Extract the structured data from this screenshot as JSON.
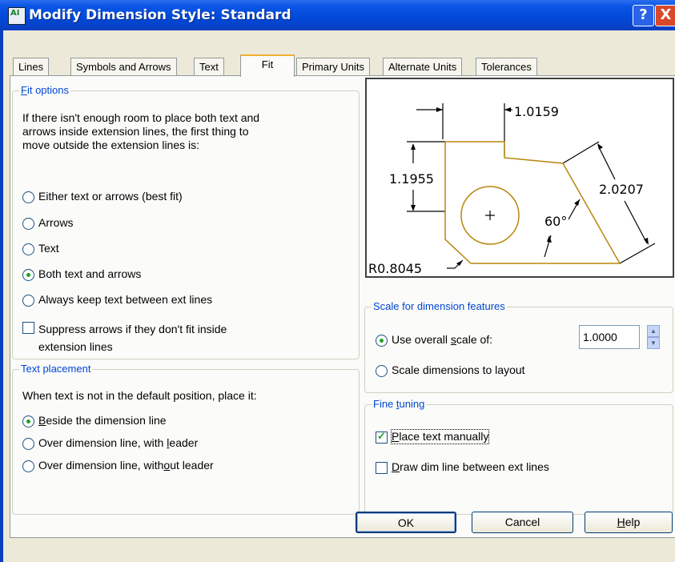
{
  "window": {
    "title": "Modify Dimension Style: Standard",
    "icon_label": "AI",
    "help_label": "?",
    "close_label": "X"
  },
  "tabs": [
    "Lines",
    "Symbols and Arrows",
    "Text",
    "Fit",
    "Primary Units",
    "Alternate Units",
    "Tolerances"
  ],
  "active_tab": "Fit",
  "fit_options": {
    "title_pre": "",
    "title_u": "F",
    "title_post": "it options",
    "description": [
      "If there isn't enough room to place both text and",
      "arrows inside extension lines, the first thing to",
      "move outside the extension lines is:"
    ],
    "options": [
      "Either text or arrows (best fit)",
      "Arrows",
      "Text",
      "Both text and arrows",
      "Always keep text between ext lines"
    ],
    "selected": "Both text and arrows",
    "suppress_label_line1": "Suppress arrows if they don't fit inside",
    "suppress_label_line2": "extension lines",
    "suppress_checked": false
  },
  "text_placement": {
    "title": "Text placement",
    "description": "When text is not in the default position, place it:",
    "opt1_u": "B",
    "opt1_rest": "eside the dimension line",
    "opt2_pre": "Over dimension line, with ",
    "opt2_u": "l",
    "opt2_post": "eader",
    "opt3_pre": "Over dimension line, with",
    "opt3_u": "o",
    "opt3_post": "ut leader",
    "selected": "Beside the dimension line"
  },
  "preview": {
    "dim_top": "1.0159",
    "dim_left": "1.1955",
    "dim_right": "2.0207",
    "dim_angle": "60°",
    "dim_radius": "R0.8045"
  },
  "scale": {
    "title": "Scale for dimension features",
    "overall_pre": "Use overall ",
    "overall_u": "s",
    "overall_post": "cale of:",
    "layout_label": "Scale dimensions to layout",
    "selected": "overall",
    "value": "1.0000"
  },
  "fine_tuning": {
    "title_pre": "Fine ",
    "title_u": "t",
    "title_post": "uning",
    "place_u": "P",
    "place_rest": "lace text manually",
    "place_checked": true,
    "draw_u": "D",
    "draw_rest": "raw dim line between ext lines",
    "draw_checked": false
  },
  "buttons": {
    "ok": "OK",
    "cancel": "Cancel",
    "help_u": "H",
    "help_rest": "elp"
  },
  "colors": {
    "title_bar": "#0a56e6",
    "shape": "#b8860b",
    "group_title": "#0046d5"
  }
}
